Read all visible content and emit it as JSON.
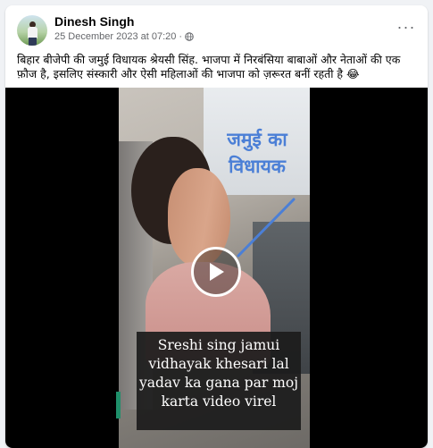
{
  "post": {
    "author": "Dinesh Singh",
    "timestamp": "25 December 2023 at 07:20",
    "separator": "·",
    "privacy_icon": "globe-icon",
    "more_label": "···",
    "text": "बिहार बीजेपी की जमुई विधायक श्रेयसी सिंह.  भाजपा में निरबंसिया बाबाओं और नेताओं की एक फ़ौज है, इसलिए संस्कारी और ऐसी महिलाओं की भाजपा को ज़रूरत बनीं रहती है 😂"
  },
  "video": {
    "overlay_label": "जमुई का विधायक",
    "caption": "Sreshi sing jamui vidhayak khesari lal yadav ka gana par moj karta video virel",
    "play_icon": "play-icon",
    "overlay_color": "#4b7fd6"
  },
  "colors": {
    "page_bg": "#f0f2f5",
    "card_bg": "#ffffff",
    "secondary_text": "#65676b"
  }
}
